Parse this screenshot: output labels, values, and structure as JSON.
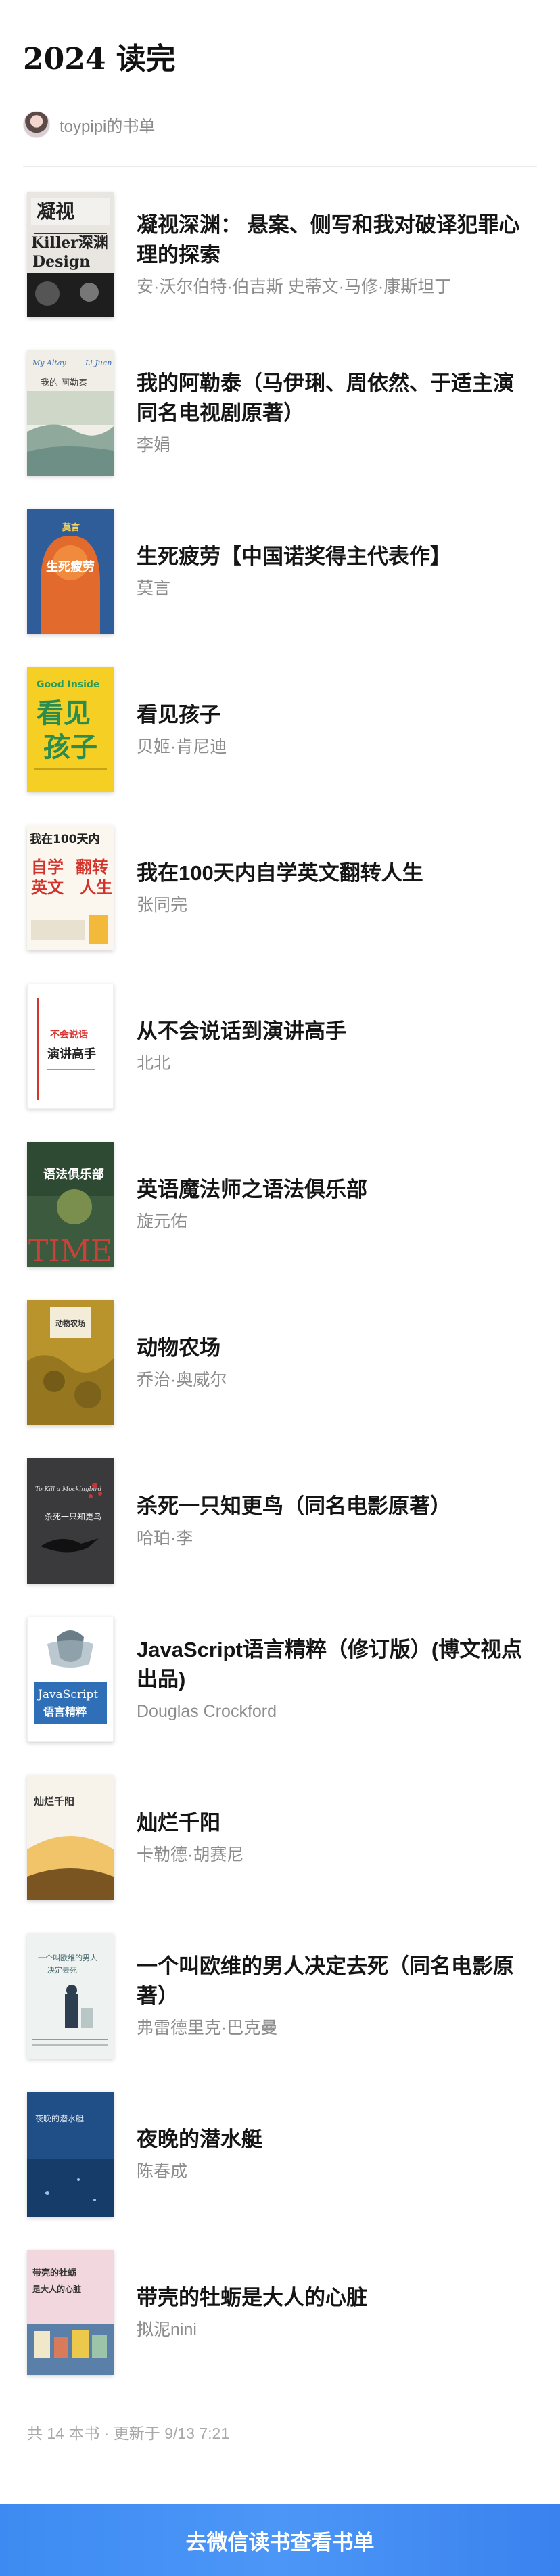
{
  "page": {
    "title": "2024 读完",
    "owner": "toypipi的书单"
  },
  "books": [
    {
      "title": "凝视深渊： 悬案、侧写和我对破译犯罪心理的探索",
      "author": "安·沃尔伯特·伯吉斯 史蒂文·马修·康斯坦丁",
      "cover_text": [
        "凝视",
        "Killer深渊",
        "Design"
      ]
    },
    {
      "title": "我的阿勒泰（马伊琍、周依然、于适主演同名电视剧原著）",
      "author": "李娟",
      "cover_text": [
        "My Altay",
        "Li Juan"
      ]
    },
    {
      "title": "生死疲劳【中国诺奖得主代表作】",
      "author": "莫言",
      "cover_text": [
        "莫言",
        "生死疲劳"
      ]
    },
    {
      "title": "看见孩子",
      "author": "贝姬·肯尼迪",
      "cover_text": [
        "Good Inside",
        "看见",
        "孩子"
      ]
    },
    {
      "title": "我在100天内自学英文翻转人生",
      "author": "张同完",
      "cover_text": [
        "我在100天内",
        "自学",
        "英文",
        "翻转",
        "人生"
      ]
    },
    {
      "title": "从不会说话到演讲高手",
      "author": "北北",
      "cover_text": [
        "不会说话",
        "演讲高手"
      ]
    },
    {
      "title": "英语魔法师之语法俱乐部",
      "author": "旋元佑",
      "cover_text": [
        "语法俱乐部",
        "TIME"
      ]
    },
    {
      "title": "动物农场",
      "author": "乔治·奥威尔",
      "cover_text": [
        "动物农场"
      ]
    },
    {
      "title": "杀死一只知更鸟（同名电影原著）",
      "author": "哈珀·李",
      "cover_text": [
        "To Kill a Mockingbird",
        "杀死一只知更鸟"
      ]
    },
    {
      "title": "JavaScript语言精粹（修订版）(博文视点出品)",
      "author": "Douglas Crockford",
      "cover_text": [
        "JavaScript",
        "语言精粹"
      ]
    },
    {
      "title": "灿烂千阳",
      "author": "卡勒德·胡赛尼",
      "cover_text": [
        "灿烂千阳"
      ]
    },
    {
      "title": "一个叫欧维的男人决定去死（同名电影原著）",
      "author": "弗雷德里克·巴克曼",
      "cover_text": [
        "一个叫欧维的男人",
        "决定去死"
      ]
    },
    {
      "title": "夜晚的潜水艇",
      "author": "陈春成",
      "cover_text": [
        "夜晚的潜水艇"
      ]
    },
    {
      "title": "带壳的牡蛎是大人的心脏",
      "author": "拟泥nini",
      "cover_text": [
        "带壳的牡蛎",
        "是大人的心脏"
      ]
    }
  ],
  "footer": {
    "summary": "共 14 本书 · 更新于 9/13 7:21",
    "cta_label": "去微信读书查看书单"
  },
  "colors": {
    "accent": "#4090f5",
    "muted": "#8c8c8c"
  },
  "icons": {
    "avatar": "avatar-icon"
  }
}
